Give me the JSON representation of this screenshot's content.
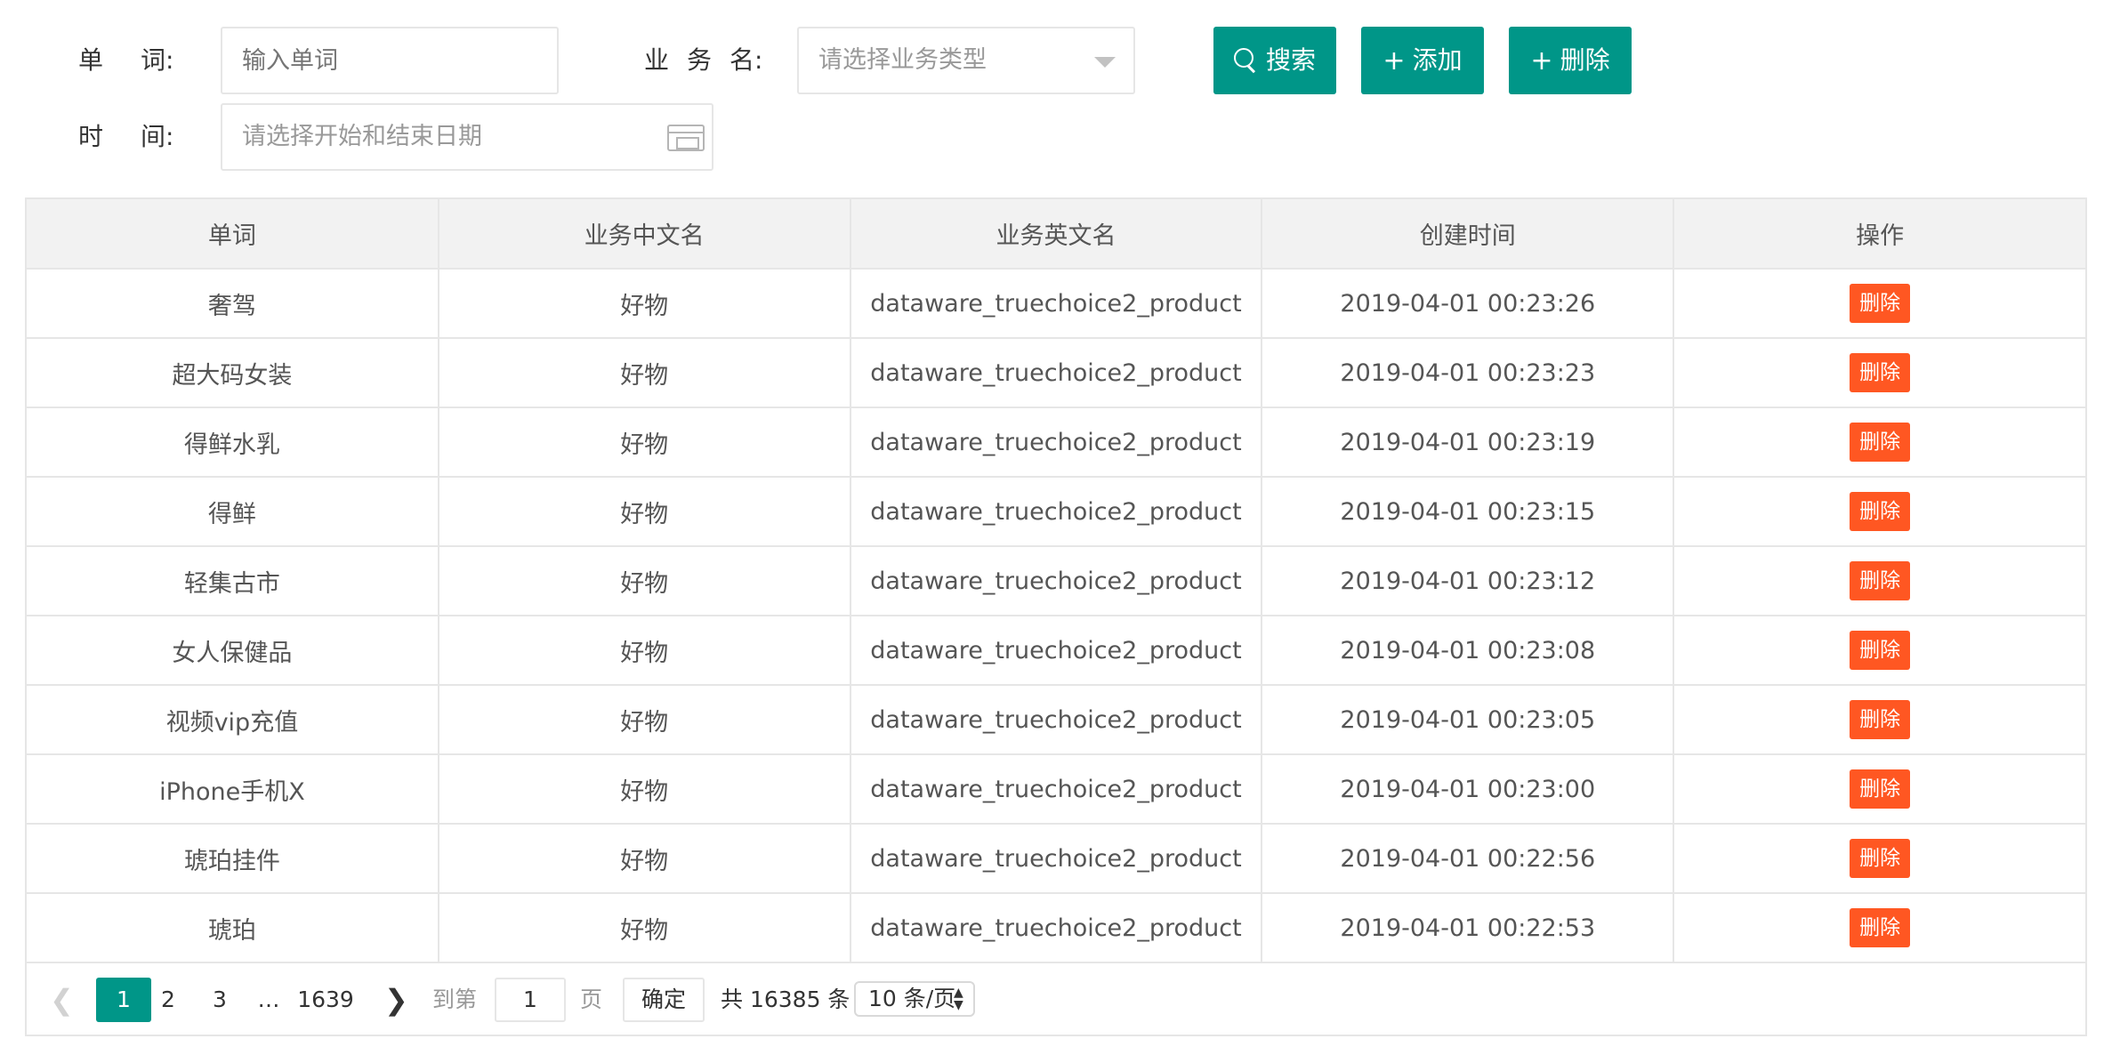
{
  "filters": {
    "word_label": [
      "单",
      "词:"
    ],
    "word_placeholder": "输入单词",
    "biz_label": [
      "业",
      "务",
      "名:"
    ],
    "biz_placeholder": "请选择业务类型",
    "time_label": [
      "时",
      "间:"
    ],
    "time_placeholder": "请选择开始和结束日期"
  },
  "buttons": {
    "search": "搜索",
    "add": "添加",
    "delete": "删除"
  },
  "table": {
    "headers": [
      "单词",
      "业务中文名",
      "业务英文名",
      "创建时间",
      "操作"
    ],
    "rows": [
      {
        "word": "奢驾",
        "cn": "好物",
        "en": "dataware_truechoice2_product",
        "time": "2019-04-01 00:23:26",
        "action": "删除"
      },
      {
        "word": "超大码女装",
        "cn": "好物",
        "en": "dataware_truechoice2_product",
        "time": "2019-04-01 00:23:23",
        "action": "删除"
      },
      {
        "word": "得鲜水乳",
        "cn": "好物",
        "en": "dataware_truechoice2_product",
        "time": "2019-04-01 00:23:19",
        "action": "删除"
      },
      {
        "word": "得鲜",
        "cn": "好物",
        "en": "dataware_truechoice2_product",
        "time": "2019-04-01 00:23:15",
        "action": "删除"
      },
      {
        "word": "轻集古市",
        "cn": "好物",
        "en": "dataware_truechoice2_product",
        "time": "2019-04-01 00:23:12",
        "action": "删除"
      },
      {
        "word": "女人保健品",
        "cn": "好物",
        "en": "dataware_truechoice2_product",
        "time": "2019-04-01 00:23:08",
        "action": "删除"
      },
      {
        "word": "视频vip充值",
        "cn": "好物",
        "en": "dataware_truechoice2_product",
        "time": "2019-04-01 00:23:05",
        "action": "删除"
      },
      {
        "word": "iPhone手机X",
        "cn": "好物",
        "en": "dataware_truechoice2_product",
        "time": "2019-04-01 00:23:00",
        "action": "删除"
      },
      {
        "word": "琥珀挂件",
        "cn": "好物",
        "en": "dataware_truechoice2_product",
        "time": "2019-04-01 00:22:56",
        "action": "删除"
      },
      {
        "word": "琥珀",
        "cn": "好物",
        "en": "dataware_truechoice2_product",
        "time": "2019-04-01 00:22:53",
        "action": "删除"
      }
    ]
  },
  "pagination": {
    "pages": [
      "1",
      "2",
      "3"
    ],
    "ellipsis": "…",
    "last_page": "1639",
    "goto_label": "到第",
    "goto_value": "1",
    "page_label": "页",
    "confirm": "确定",
    "total": "共 16385 条",
    "page_size": "10 条/页"
  },
  "colors": {
    "primary": "#009688",
    "danger": "#ff5722",
    "header_bg": "#f2f2f2",
    "border": "#e6e6e6"
  }
}
